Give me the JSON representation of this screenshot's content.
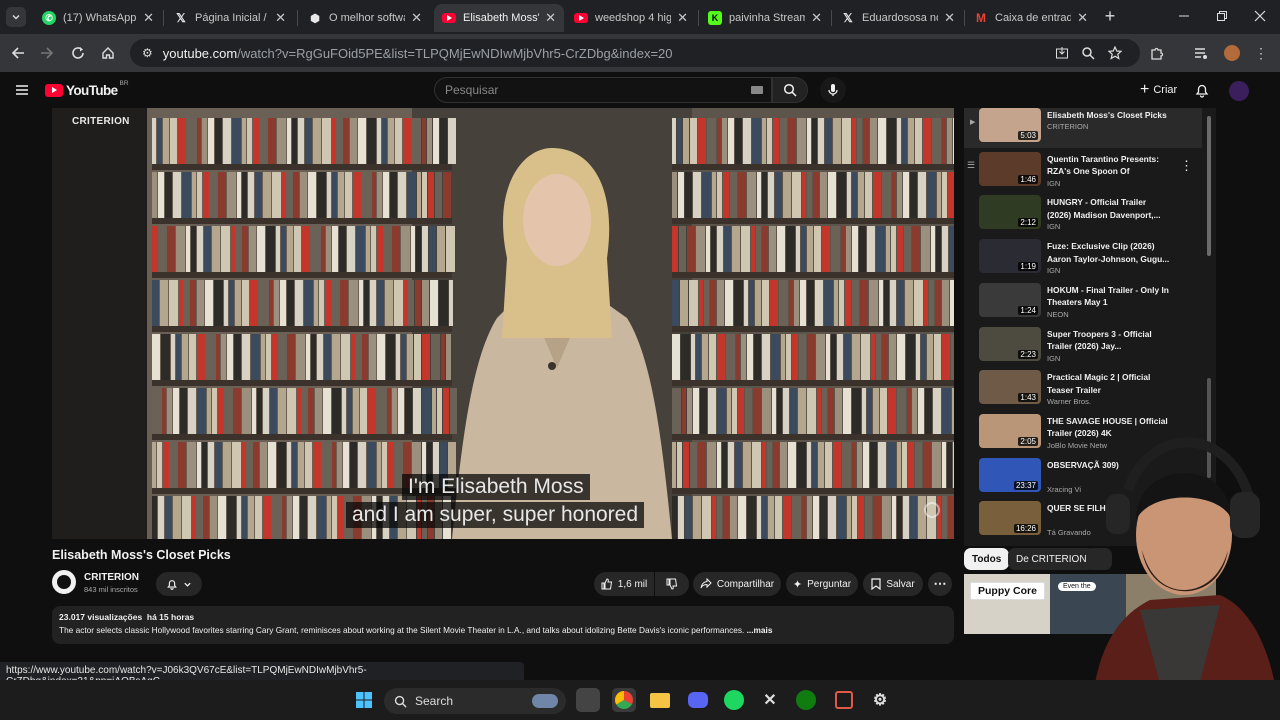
{
  "browser": {
    "tabs": [
      {
        "label": "(17) WhatsApp",
        "icon": "whatsapp-icon",
        "color": "#25d366"
      },
      {
        "label": "Página Inicial / X",
        "icon": "x-icon",
        "color": "#e8e8e8"
      },
      {
        "label": "O melhor softwa",
        "icon": "shield-icon",
        "color": "#e8e8e8"
      },
      {
        "label": "Elisabeth Moss's",
        "icon": "youtube-icon",
        "color": "#ff0033"
      },
      {
        "label": "weedshop 4 high",
        "icon": "youtube-icon",
        "color": "#ff0033"
      },
      {
        "label": "paivinha Stream",
        "icon": "kick-icon",
        "color": "#53fc18"
      },
      {
        "label": "Eduardososa no",
        "icon": "x-icon",
        "color": "#e8e8e8"
      },
      {
        "label": "Caixa de entrad",
        "icon": "gmail-icon",
        "color": "#ea4335"
      }
    ],
    "url_host": "youtube.com",
    "url_path": "/watch?v=RgGuFOid5PE&list=TLPQMjEwNDIwMjbVhr5-CrZDbg&index=20"
  },
  "youtube": {
    "logo_text": "YouTube",
    "region": "BR",
    "search_placeholder": "Pesquisar",
    "create_label": "Criar"
  },
  "video": {
    "watermark": "CRITERION",
    "caption_line1": "I'm Elisabeth Moss",
    "caption_line2": "and I am super, super honored",
    "title": "Elisabeth Moss's Closet Picks",
    "channel": "CRITERION",
    "subscribers": "843 mil inscritos",
    "likes": "1,6 mil",
    "share": "Compartilhar",
    "ask": "Perguntar",
    "save": "Salvar",
    "views": "23.017 visualizações",
    "age": "há 15 horas",
    "description": "The actor selects classic Hollywood favorites starring Cary Grant, reminisces about working at the Silent Movie Theater in L.A., and talks about idolizing Bette Davis's iconic performances.",
    "more": "...mais"
  },
  "playlist": [
    {
      "title": "Elisabeth Moss's Closet Picks",
      "channel": "CRITERION",
      "duration": "5:03"
    },
    {
      "title": "Quentin Tarantino Presents: RZA's One Spoon Of Chocola...",
      "channel": "IGN",
      "duration": "1:46"
    },
    {
      "title": "HUNGRY - Official Trailer (2026) Madison Davenport,...",
      "channel": "IGN",
      "duration": "2:12"
    },
    {
      "title": "Fuze: Exclusive Clip (2026) Aaron Taylor-Johnson, Gugu...",
      "channel": "IGN",
      "duration": "1:19"
    },
    {
      "title": "HOKUM - Final Trailer - Only In Theaters May 1",
      "channel": "NEON",
      "duration": "1:24"
    },
    {
      "title": "Super Troopers 3 - Official Trailer (2026) Jay...",
      "channel": "IGN",
      "duration": "2:23"
    },
    {
      "title": "Practical Magic 2 | Official Teaser Trailer",
      "channel": "Warner Bros.",
      "duration": "1:43"
    },
    {
      "title": "THE SAVAGE HOUSE | Official Trailer (2026) 4K",
      "channel": "JoBlo Movie Netw",
      "duration": "2:05"
    },
    {
      "title": "OBSERVAÇÃ 309)",
      "channel": "Xracing Vi",
      "duration": "23:37"
    },
    {
      "title": "QUER SE FILHOS?",
      "channel": "Tá Gravando",
      "duration": "16:26"
    }
  ],
  "chips": {
    "all": "Todos",
    "from": "De CRITERION"
  },
  "recommendation_label": "Puppy Core",
  "recommendation_small": "Even the",
  "status_url": "https://www.youtube.com/watch?v=J06k3QV67cE&list=TLPQMjEwNDIwMjbVhr5-CrZDbg&index=21&pp=iAQBsAgC",
  "taskbar": {
    "search": "Search"
  },
  "colors": {
    "youtube_red": "#ff0033",
    "background": "#0f0f0f",
    "chrome_dark": "#202124"
  }
}
